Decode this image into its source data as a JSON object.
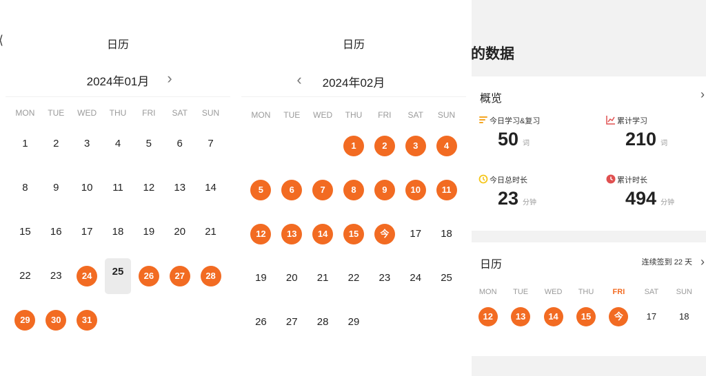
{
  "calendar_jan": {
    "title": "日历",
    "month_label": "2024年01月",
    "weekdays": [
      "MON",
      "TUE",
      "WED",
      "THU",
      "FRI",
      "SAT",
      "SUN"
    ],
    "leading_blanks": 0,
    "days": [
      "1",
      "2",
      "3",
      "4",
      "5",
      "6",
      "7",
      "8",
      "9",
      "10",
      "11",
      "12",
      "13",
      "14",
      "15",
      "16",
      "17",
      "18",
      "19",
      "20",
      "21",
      "22",
      "23",
      "24",
      "25",
      "26",
      "27",
      "28",
      "29",
      "30",
      "31"
    ],
    "checked_days": [
      "24",
      "26",
      "27",
      "28",
      "29",
      "30",
      "31"
    ],
    "highlighted_day": "25"
  },
  "calendar_feb": {
    "title": "日历",
    "month_label": "2024年02月",
    "weekdays": [
      "MON",
      "TUE",
      "WED",
      "THU",
      "FRI",
      "SAT",
      "SUN"
    ],
    "leading_blanks": 3,
    "days": [
      "1",
      "2",
      "3",
      "4",
      "5",
      "6",
      "7",
      "8",
      "9",
      "10",
      "11",
      "12",
      "13",
      "14",
      "15",
      "今",
      "17",
      "18",
      "19",
      "20",
      "21",
      "22",
      "23",
      "24",
      "25",
      "26",
      "27",
      "28",
      "29"
    ],
    "checked_days": [
      "1",
      "2",
      "3",
      "4",
      "5",
      "6",
      "7",
      "8",
      "9",
      "10",
      "11",
      "12",
      "13",
      "14",
      "15",
      "今"
    ]
  },
  "mydata": {
    "title": "我的数据",
    "overview": {
      "heading": "概览",
      "stats": [
        {
          "label": "今日学习&复习",
          "value": "50",
          "unit": "词",
          "icon": "bars-icon",
          "color": "#f5a623"
        },
        {
          "label": "累计学习",
          "value": "210",
          "unit": "词",
          "icon": "trend-chart-icon",
          "color": "#e05050"
        },
        {
          "label": "今日总时长",
          "value": "23",
          "unit": "分钟",
          "icon": "timer-icon",
          "color": "#f5c518"
        },
        {
          "label": "累计时长",
          "value": "494",
          "unit": "分钟",
          "icon": "clock-icon",
          "color": "#e05050"
        }
      ]
    },
    "calendar": {
      "heading": "日历",
      "streak": "连续签到 22 天",
      "weekdays": [
        "MON",
        "TUE",
        "WED",
        "THU",
        "FRI",
        "SAT",
        "SUN"
      ],
      "current_weekday": "FRI",
      "days": [
        "12",
        "13",
        "14",
        "15",
        "今",
        "17",
        "18"
      ],
      "checked_days": [
        "12",
        "13",
        "14",
        "15",
        "今"
      ]
    }
  },
  "colors": {
    "accent": "#f26b22",
    "today_bg": "#ebebeb",
    "panel_bg": "#f2f2f2"
  }
}
